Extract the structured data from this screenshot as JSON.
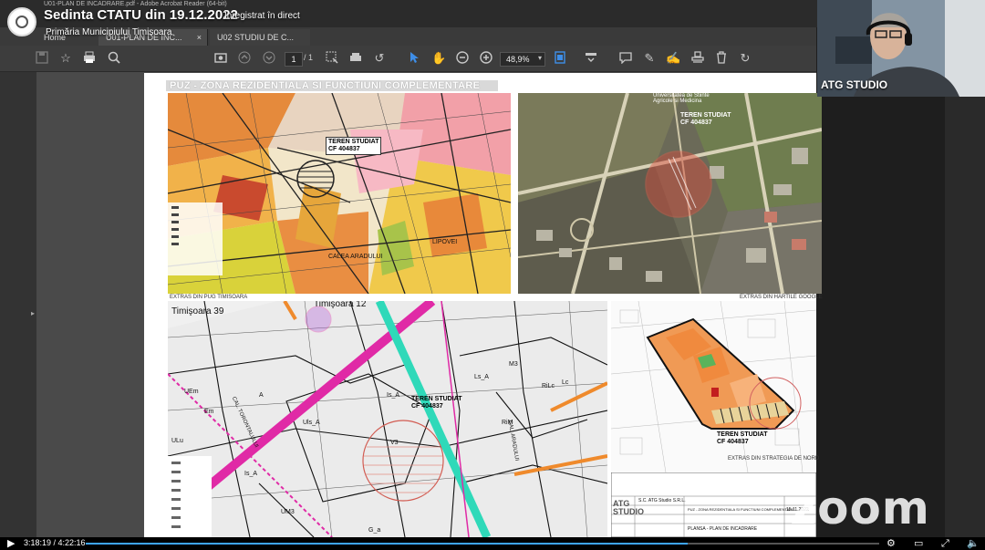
{
  "acrobat": {
    "window_title": "U01-PLAN DE INCADRARE.pdf - Adobe Acrobat Reader (64-bit)",
    "tabs": [
      {
        "label": "Home"
      },
      {
        "label": "U01-PLAN DE INC..."
      },
      {
        "label": "U02 STUDIU DE C..."
      }
    ],
    "close_symbol": "×",
    "page_current": "1",
    "page_total": "/ 1",
    "zoom_level": "48,9%"
  },
  "pdf": {
    "title": "PUZ - ZONA REZIDENTIALA SI FUNCTIUNI COMPLEMENTARE",
    "panels": {
      "pug": {
        "caption": "EXTRAS DIN PUG TIMISOARA",
        "target_label_line1": "TEREN STUDIAT",
        "target_label_line2": "CF 404837",
        "street_1": "CALEA ARADULUI",
        "street_2": "LIPOVEI"
      },
      "google": {
        "caption": "EXTRAS DIN HARTILE GOOGLE",
        "target_label_line1": "TEREN STUDIAT",
        "target_label_line2": "CF 404837",
        "poi": "Universitatea de Stiinte Agricole si Medicina"
      },
      "zoning": {
        "label_north": "Timişoara 12",
        "label_west": "Timişoara 39",
        "target_label_line1": "TEREN STUDIAT",
        "target_label_line2": "CF 404837",
        "zones": [
          "A",
          "Uls_A",
          "Is_A",
          "Is_A",
          "M3",
          "Lc",
          "RiM",
          "RiLc",
          "Ls_A",
          "UEm",
          "Em",
          "ULu",
          "UM3",
          "G_a",
          "V3",
          "CAL. ARADULUI",
          "CAL. TORONTALULUI"
        ]
      },
      "nord": {
        "caption": "EXTRAS DIN STRATEGIA DE NORD",
        "target_label_line1": "TEREN STUDIAT",
        "target_label_line2": "CF 404837"
      },
      "titleblock": {
        "company": "S.C. ATG Studio S.R.L.",
        "project": "PUZ - ZONA REZIDENTIALA SI FUNCTIUNI COMPLEMENTARE",
        "sheet": "PLANSA - PLAN DE INCADRARE",
        "date": "15.11.2022",
        "logo_text": "ATG STUDIO"
      }
    }
  },
  "zoom": {
    "meeting_title": "Sedinta CTATU din 19.12.2022",
    "live_label": "Înregistrat în direct",
    "org_name": "Primăria Municipiului Timișoara",
    "speaker_name": "ATG STUDIO",
    "watermark": "zoom",
    "more_icon": "⋮"
  },
  "player": {
    "time": "3:18:19 / 4:22:16",
    "progress_fraction": 0.759
  }
}
